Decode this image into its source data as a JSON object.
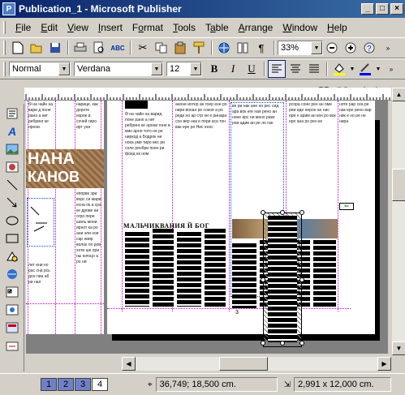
{
  "window": {
    "title": "Publication_1 - Microsoft Publisher",
    "app_icon": "P"
  },
  "menu": [
    "File",
    "Edit",
    "View",
    "Insert",
    "Format",
    "Tools",
    "Table",
    "Arrange",
    "Window",
    "Help"
  ],
  "menu_underline": [
    "F",
    "E",
    "V",
    "I",
    "o",
    "T",
    "a",
    "A",
    "W",
    "H"
  ],
  "standard_toolbar": {
    "zoom_value": "33%"
  },
  "format_toolbar": {
    "style_value": "Normal",
    "font_value": "Verdana",
    "size_value": "12"
  },
  "status": {
    "pages": [
      "1",
      "2",
      "3",
      "4"
    ],
    "current_page": "4",
    "position": "36,749; 18,500 cm.",
    "size": "2,991 x 12,000 cm."
  },
  "document": {
    "heading_left": "НАНА",
    "heading_left2": "КАНОВ",
    "article_heading": "МАЛЬЧИКВАНИЯ Й БОГ",
    "page_number": "3",
    "colors": {
      "accent": "#c000c0",
      "frame": "#0050c8"
    }
  },
  "icons": {
    "standard": [
      "new-icon",
      "open-icon",
      "save-icon",
      "print-preview-icon",
      "print-icon",
      "spelling-icon",
      "cut-icon",
      "copy-icon",
      "paste-icon",
      "format-painter-icon",
      "insert-hyperlink-icon",
      "columns-icon",
      "special-characters-icon",
      "zoom-out-icon",
      "zoom-in-icon",
      "help-icon"
    ],
    "objects": [
      "pointer-icon",
      "text-box-icon",
      "table-icon",
      "wordart-icon",
      "picture-icon",
      "clip-art-icon",
      "line-icon",
      "arrow-icon",
      "oval-icon",
      "rectangle-icon",
      "autoshapes-icon",
      "hot-spot-icon",
      "form-control-icon",
      "html-fragment-icon",
      "design-gallery-icon",
      "insert-object-icon"
    ]
  }
}
